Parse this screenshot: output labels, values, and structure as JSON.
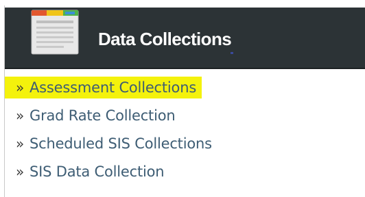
{
  "header": {
    "title": "Data Collections",
    "icon": "document-list-icon",
    "background_color": "#2c3336"
  },
  "links": [
    {
      "bullet": "»",
      "label": "Assessment Collections",
      "highlighted": true
    },
    {
      "bullet": "»",
      "label": "Grad Rate Collection",
      "highlighted": false
    },
    {
      "bullet": "»",
      "label": "Scheduled SIS Collections",
      "highlighted": false
    },
    {
      "bullet": "»",
      "label": "SIS Data Collection",
      "highlighted": false
    }
  ],
  "colors": {
    "link_text": "#3e5d74",
    "highlight": "#f4f20c"
  }
}
